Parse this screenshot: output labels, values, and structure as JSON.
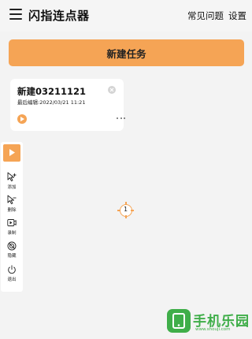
{
  "header": {
    "title": "闪指连点器",
    "faq_label": "常见问题",
    "settings_label": "设置"
  },
  "new_task_button": "新建任务",
  "task_card": {
    "name": "新建03211121",
    "last_edit": "最后编辑:2022/03/21 11:21"
  },
  "toolbar": {
    "add_label": "添加",
    "delete_label": "删除",
    "record_label": "录制",
    "hide_label": "隐藏",
    "exit_label": "退出"
  },
  "click_point": {
    "number": "1"
  },
  "watermark": {
    "title": "手机乐园",
    "url": "www.shouji.com"
  },
  "colors": {
    "accent": "#f5a455",
    "background": "#f3f3f3",
    "watermark": "#3fae49"
  }
}
